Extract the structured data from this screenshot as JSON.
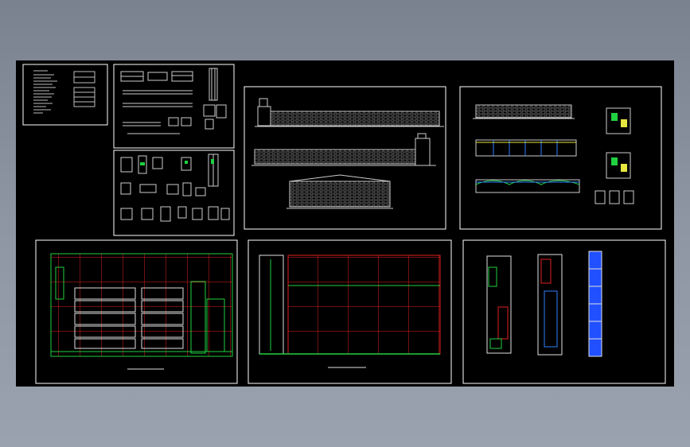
{
  "canvas": {
    "background": "#000000",
    "frame_color": "#ffffff",
    "grid_color": "#e02020",
    "wall_color": "#20d040",
    "accent_color": "#3080ff",
    "window_fill": "#2050ff"
  },
  "sheets": [
    {
      "id": "notes-sheet",
      "kind": "design-notes"
    },
    {
      "id": "details-sheet-a",
      "kind": "sections"
    },
    {
      "id": "details-sheet-b",
      "kind": "details"
    },
    {
      "id": "elevations-sheet",
      "kind": "elevations"
    },
    {
      "id": "sections-sheet",
      "kind": "sections"
    },
    {
      "id": "floor-plan-sheet",
      "kind": "plan"
    },
    {
      "id": "roof-plan-sheet",
      "kind": "plan"
    },
    {
      "id": "office-plans-sheet",
      "kind": "plan"
    }
  ]
}
